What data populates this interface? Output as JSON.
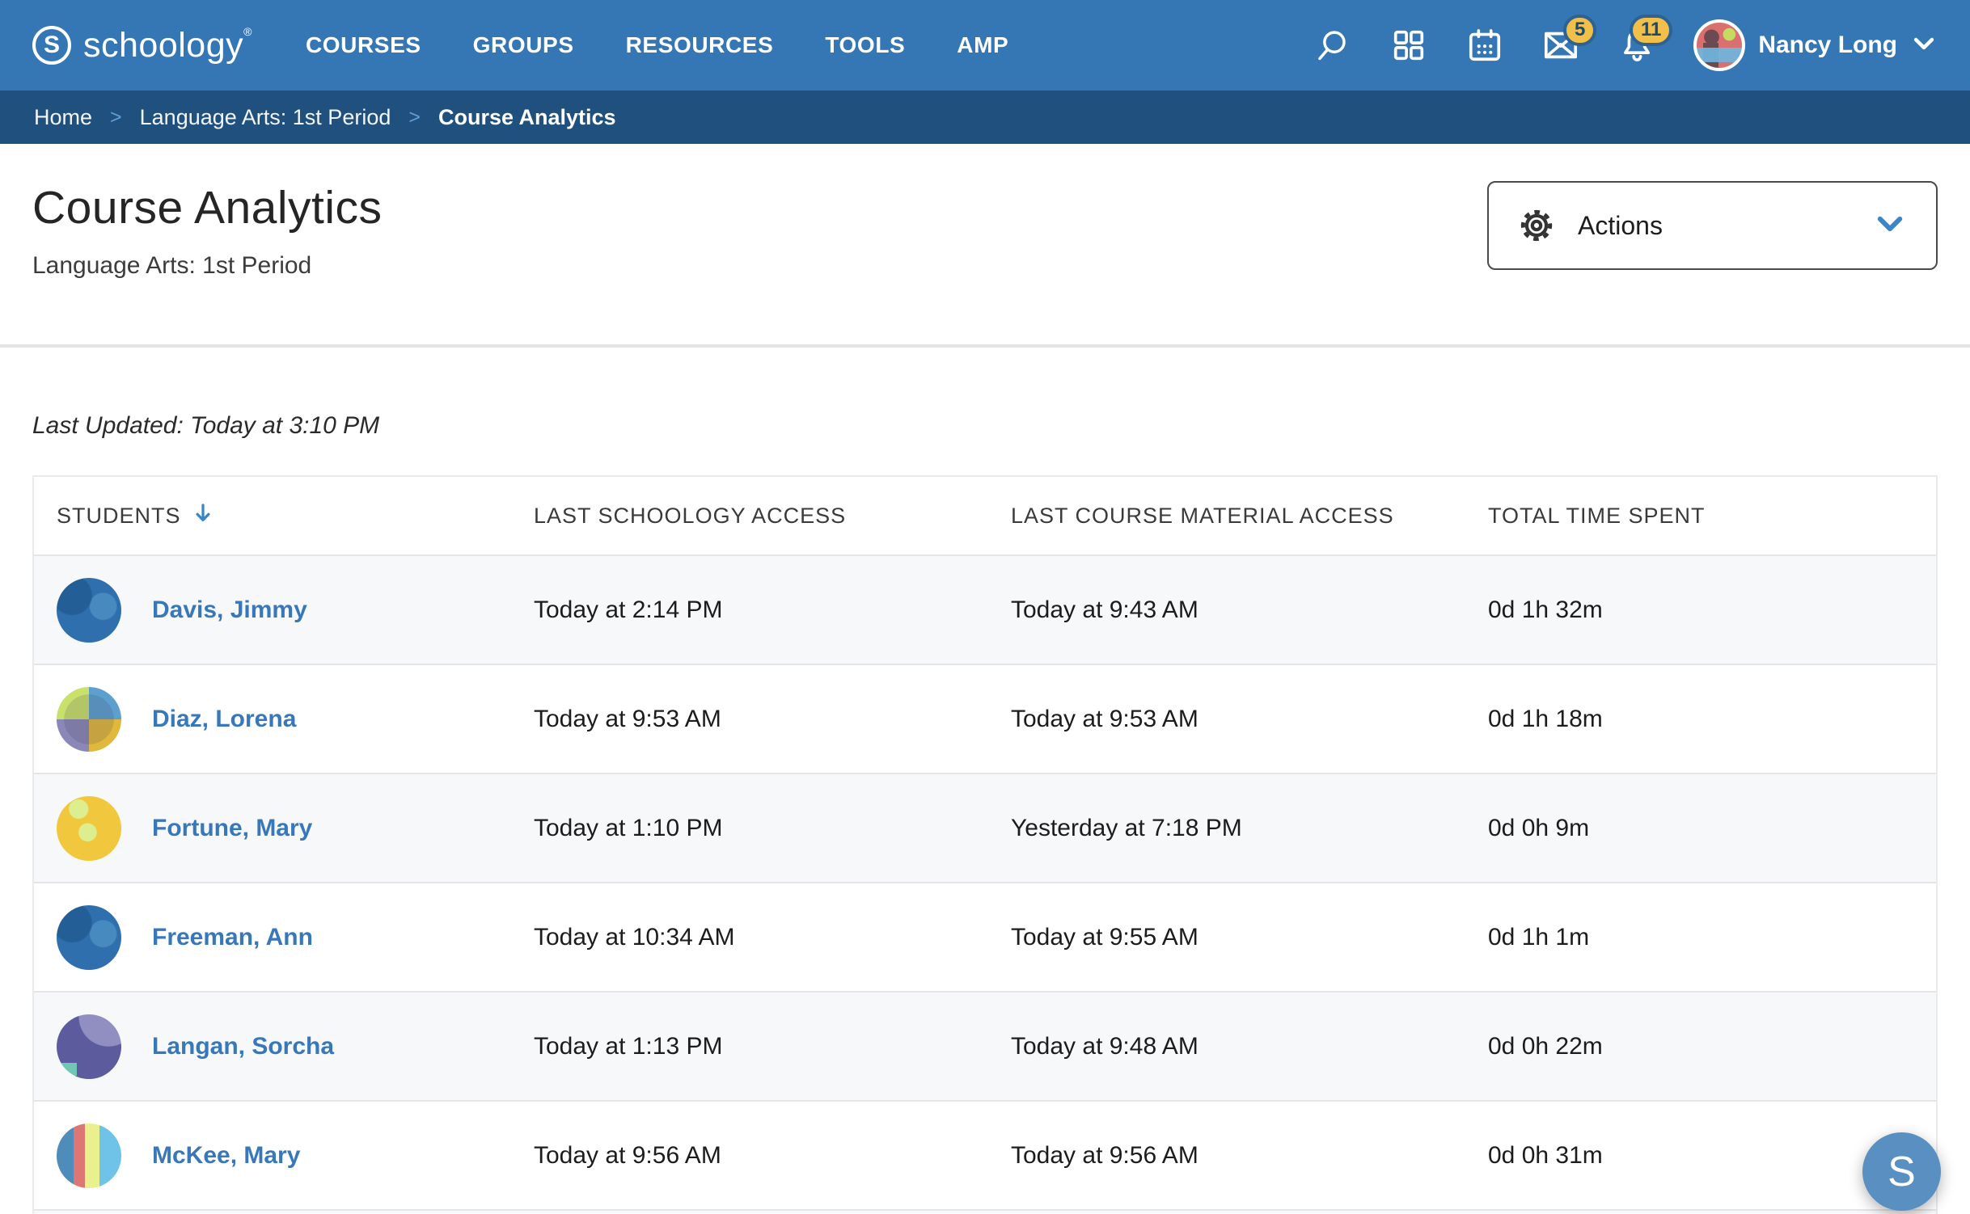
{
  "brand": {
    "logo_letter": "S",
    "name": "schoology",
    "trademark": "®"
  },
  "nav": {
    "items": [
      "COURSES",
      "GROUPS",
      "RESOURCES",
      "TOOLS",
      "AMP"
    ]
  },
  "header_icons": {
    "search": "search-icon",
    "apps": "app-grid-icon",
    "calendar": "calendar-icon",
    "messages": "envelope-icon",
    "messages_badge": "5",
    "notifications": "bell-icon",
    "notifications_badge": "11"
  },
  "user": {
    "name": "Nancy Long"
  },
  "breadcrumb": {
    "separator": ">",
    "items": [
      "Home",
      "Language Arts: 1st Period",
      "Course Analytics"
    ]
  },
  "page": {
    "title": "Course Analytics",
    "subtitle": "Language Arts: 1st Period",
    "actions_label": "Actions",
    "last_updated": "Last Updated: Today at 3:10 PM"
  },
  "table": {
    "columns": [
      "STUDENTS",
      "LAST SCHOOLOGY ACCESS",
      "LAST COURSE MATERIAL ACCESS",
      "TOTAL TIME SPENT"
    ],
    "sort_column": "STUDENTS",
    "sort_direction": "descending",
    "rows": [
      {
        "name": "Davis, Jimmy",
        "avatar_style": "blue-abstract",
        "last_schoology_access": "Today at 2:14 PM",
        "last_material_access": "Today at 9:43 AM",
        "total_time_spent": "0d 1h 32m"
      },
      {
        "name": "Diaz, Lorena",
        "avatar_style": "quadrant-circle",
        "last_schoology_access": "Today at 9:53 AM",
        "last_material_access": "Today at 9:53 AM",
        "total_time_spent": "0d 1h 18m"
      },
      {
        "name": "Fortune, Mary",
        "avatar_style": "gold-abstract",
        "last_schoology_access": "Today at 1:10 PM",
        "last_material_access": "Yesterday at 7:18 PM",
        "total_time_spent": "0d 0h 9m"
      },
      {
        "name": "Freeman, Ann",
        "avatar_style": "blue-abstract",
        "last_schoology_access": "Today at 10:34 AM",
        "last_material_access": "Today at 9:55 AM",
        "total_time_spent": "0d 1h 1m"
      },
      {
        "name": "Langan, Sorcha",
        "avatar_style": "purple-abstract",
        "last_schoology_access": "Today at 1:13 PM",
        "last_material_access": "Today at 9:48 AM",
        "total_time_spent": "0d 0h 22m"
      },
      {
        "name": "McKee, Mary",
        "avatar_style": "stripe-circle",
        "last_schoology_access": "Today at 9:56 AM",
        "last_material_access": "Today at 9:56 AM",
        "total_time_spent": "0d 0h 31m"
      }
    ]
  },
  "floating_button": {
    "label": "S"
  },
  "colors": {
    "nav_blue": "#3577b5",
    "breadcrumb_blue": "#20507e",
    "badge_gold": "#f0c04a",
    "link_blue": "#3878ba",
    "accent_chevron": "#3a86c8",
    "row_alt": "#f7f8f9"
  }
}
